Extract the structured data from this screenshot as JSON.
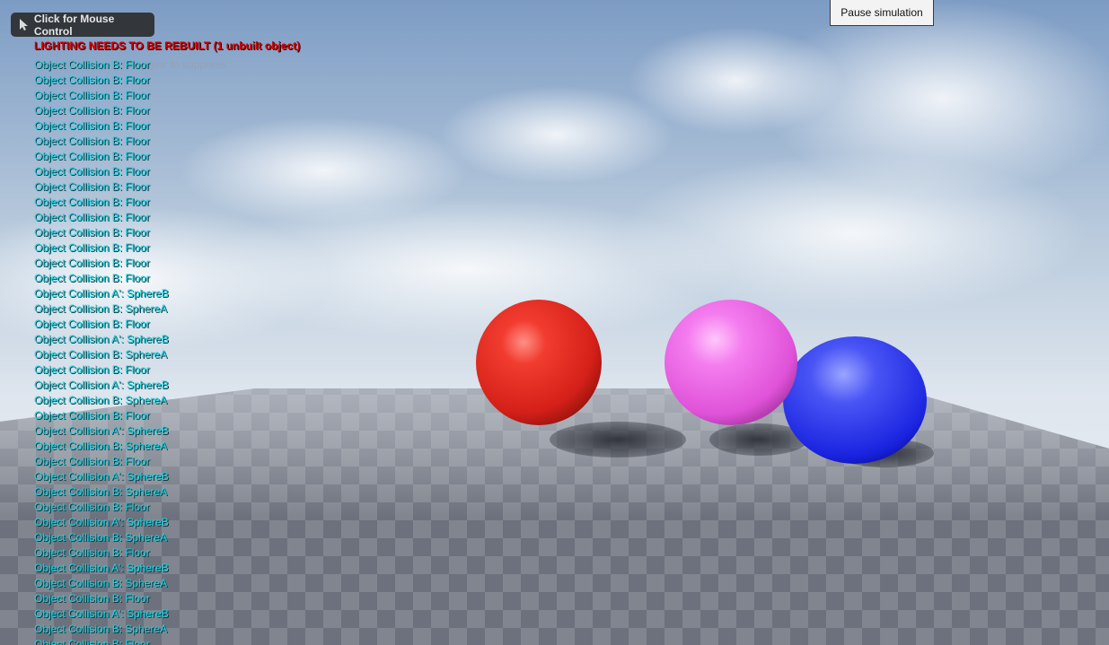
{
  "overlay": {
    "mouse_control_label": "Click for Mouse Control",
    "pause_button_label": "Pause simulation",
    "lighting_warning": "LIGHTING NEEDS TO BE REBUILT (1 unbuilt object)",
    "suppress_hint": "DisableAllScreenMessages' to suppress"
  },
  "messages": [
    "Object Collision B: Floor",
    "Object Collision B: Floor",
    "Object Collision B: Floor",
    "Object Collision B: Floor",
    "Object Collision B: Floor",
    "Object Collision B: Floor",
    "Object Collision B: Floor",
    "Object Collision B: Floor",
    "Object Collision B: Floor",
    "Object Collision B: Floor",
    "Object Collision B: Floor",
    "Object Collision B: Floor",
    "Object Collision B: Floor",
    "Object Collision B: Floor",
    "Object Collision B: Floor",
    "Object Collision A': SphereB",
    "Object Collision B: SphereA",
    "Object Collision B: Floor",
    "Object Collision A': SphereB",
    "Object Collision B: SphereA",
    "Object Collision B: Floor",
    "Object Collision A': SphereB",
    "Object Collision B: SphereA",
    "Object Collision B: Floor",
    "Object Collision A': SphereB",
    "Object Collision B: SphereA",
    "Object Collision B: Floor",
    "Object Collision A': SphereB",
    "Object Collision B: SphereA",
    "Object Collision B: Floor",
    "Object Collision A': SphereB",
    "Object Collision B: SphereA",
    "Object Collision B: Floor",
    "Object Collision A': SphereB",
    "Object Collision B: SphereA",
    "Object Collision B: Floor",
    "Object Collision A': SphereB",
    "Object Collision B: SphereA",
    "Object Collision B: Floor"
  ],
  "scene": {
    "spheres": [
      {
        "color": "#e8322a"
      },
      {
        "color": "#f070e8"
      },
      {
        "color": "#2a3cf0"
      }
    ]
  }
}
